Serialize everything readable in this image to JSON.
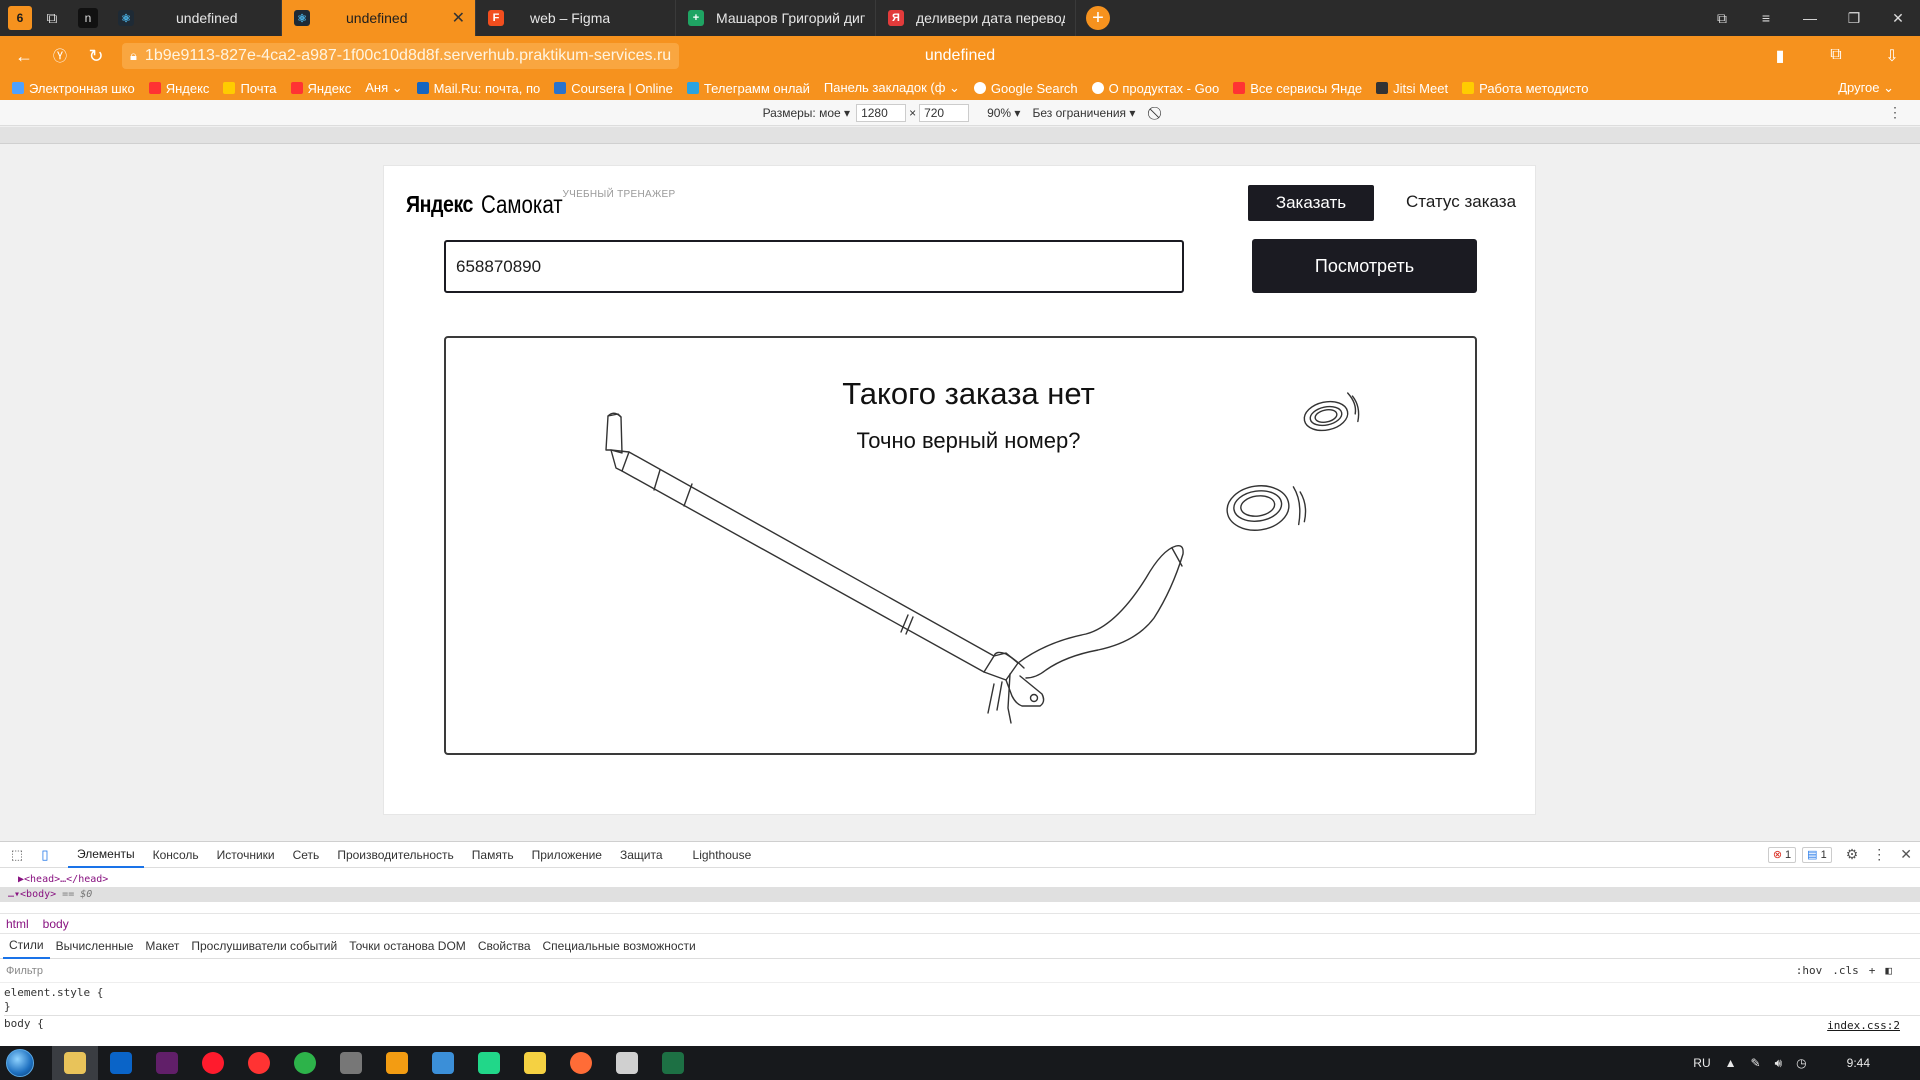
{
  "browser": {
    "tab_counter": "6",
    "tabs": [
      {
        "label": "undefined",
        "favicon_color": "#4bb3e6",
        "active": false
      },
      {
        "label": "undefined",
        "favicon_color": "#4bb3e6",
        "active": true
      },
      {
        "label": "web – Figma",
        "favicon_color": "#f24e1e",
        "active": false
      },
      {
        "label": "Машаров Григорий дипл",
        "favicon_color": "#1fa463",
        "active": false
      },
      {
        "label": "деливери дата перевод",
        "favicon_color": "#e23b3b",
        "active": false
      }
    ],
    "active_tab_close": "✕",
    "new_tab": "+",
    "window_controls": {
      "collections": "⧉",
      "menu": "≡",
      "minimize": "—",
      "restore": "❐",
      "close": "✕"
    },
    "url": "1b9e9113-827e-4ca2-a987-1f00c10d8d8f.serverhub.praktikum-services.ru",
    "page_title": "undefined",
    "bookmarks": [
      {
        "label": "Электронная шко",
        "color": "#4ea1ff"
      },
      {
        "label": "Яндекс",
        "color": "#ff3333"
      },
      {
        "label": "Почта",
        "color": "#ffcc00"
      },
      {
        "label": "Яндекс",
        "color": "#ff3333"
      },
      {
        "label": "Аня ⌄",
        "color": ""
      },
      {
        "label": "Mail.Ru: почта, по",
        "color": "#1565c0"
      },
      {
        "label": "Coursera | Online",
        "color": "#2a73cc"
      },
      {
        "label": "Телеграмм онлай",
        "color": "#2aa3e0"
      },
      {
        "label": "Панель закладок (ф ⌄",
        "color": ""
      },
      {
        "label": "Google Search",
        "color": "#ffffff"
      },
      {
        "label": "О продуктах - Goo",
        "color": "#ffffff"
      },
      {
        "label": "Все сервисы Янде",
        "color": "#ff3333"
      },
      {
        "label": "Jitsi Meet",
        "color": "#333333"
      },
      {
        "label": "Работа методисто",
        "color": "#ffcc00"
      }
    ],
    "bookmarks_other": "Другое ⌄"
  },
  "device_toolbar": {
    "dimensions_label": "Размеры: мое ▾",
    "width": "1280",
    "times": "×",
    "height": "720",
    "zoom": "90% ▾",
    "throttle": "Без ограничения ▾"
  },
  "site": {
    "brand_ya": "Яндекс",
    "brand_samokat": "Самокат",
    "brand_trainer": "УЧЕБНЫЙ ТРЕНАЖЕР",
    "order_button": "Заказать",
    "status_link": "Статус заказа",
    "order_number": "658870890",
    "view_button": "Посмотреть",
    "not_found_title": "Такого заказа нет",
    "not_found_subtitle": "Точно верный номер?"
  },
  "devtools": {
    "tabs": [
      "Элементы",
      "Консоль",
      "Источники",
      "Сеть",
      "Производительность",
      "Память",
      "Приложение",
      "Защита",
      "Lighthouse"
    ],
    "errors": "1",
    "messages": "1",
    "dom_head": "▶<head>…</head>",
    "dom_body": "…▾<body>",
    "dom_body_eq": "== $0",
    "breadcrumbs": [
      "html",
      "body"
    ],
    "subtabs": [
      "Стили",
      "Вычисленные",
      "Макет",
      "Прослушиватели событий",
      "Точки останова DOM",
      "Свойства",
      "Специальные возможности"
    ],
    "filter_placeholder": "Фильтр",
    "filter_hov": ":hov",
    "filter_cls": ".cls",
    "filter_plus": "+",
    "styles_line1": "element.style {",
    "styles_line2": "}",
    "styles_line3": "body {",
    "css_source": "index.css:2"
  },
  "taskbar": {
    "lang": "RU",
    "time": "9:44",
    "apps": [
      {
        "name": "explorer",
        "color": "#e8c35a"
      },
      {
        "name": "outlook",
        "color": "#0a64c8"
      },
      {
        "name": "slack",
        "color": "#611f69"
      },
      {
        "name": "opera",
        "color": "#ff1b2d"
      },
      {
        "name": "yandex",
        "color": "#ff3333"
      },
      {
        "name": "chrome",
        "color": "#2db34a"
      },
      {
        "name": "app",
        "color": "#777777"
      },
      {
        "name": "media",
        "color": "#f39c12"
      },
      {
        "name": "notepad",
        "color": "#3b8fd8"
      },
      {
        "name": "pycharm",
        "color": "#21d789"
      },
      {
        "name": "notes",
        "color": "#f5d142"
      },
      {
        "name": "postman",
        "color": "#ff6c37"
      },
      {
        "name": "files",
        "color": "#d0d0d0"
      },
      {
        "name": "excel",
        "color": "#1d7044"
      }
    ]
  }
}
